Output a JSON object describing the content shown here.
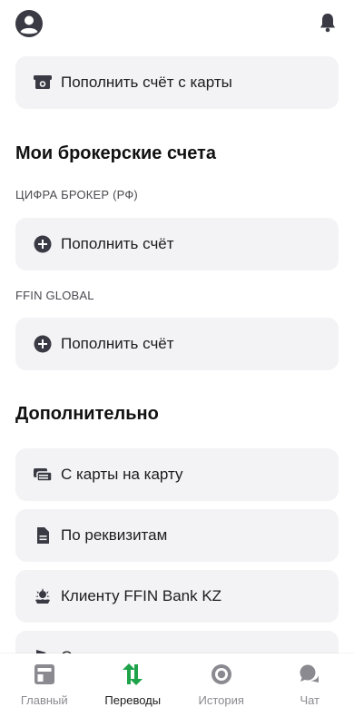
{
  "top_card": {
    "label": "Пополнить счёт с карты"
  },
  "brokerage": {
    "title": "Мои брокерские счета",
    "accounts": [
      {
        "name": "ЦИФРА БРОКЕР (РФ)",
        "action": "Пополнить счёт"
      },
      {
        "name": "FFIN GLOBAL",
        "action": "Пополнить счёт"
      }
    ]
  },
  "extra": {
    "title": "Дополнительно",
    "items": [
      {
        "label": "С карты на карту",
        "icon": "cards-icon"
      },
      {
        "label": "По реквизитам",
        "icon": "document-icon"
      },
      {
        "label": "Клиенту FFIN Bank KZ",
        "icon": "bank-emblem-icon"
      },
      {
        "label": "С...",
        "icon": "flag-icon"
      }
    ]
  },
  "tabs": [
    {
      "label": "Главный",
      "icon": "home-icon",
      "active": false
    },
    {
      "label": "Переводы",
      "icon": "transfer-icon",
      "active": true
    },
    {
      "label": "История",
      "icon": "history-icon",
      "active": false
    },
    {
      "label": "Чат",
      "icon": "chat-icon",
      "active": false
    }
  ],
  "colors": {
    "card_bg": "#f3f3f6",
    "icon_dark": "#3a3a44",
    "accent_green": "#1fa34a",
    "tab_inactive": "#8a8a90"
  }
}
